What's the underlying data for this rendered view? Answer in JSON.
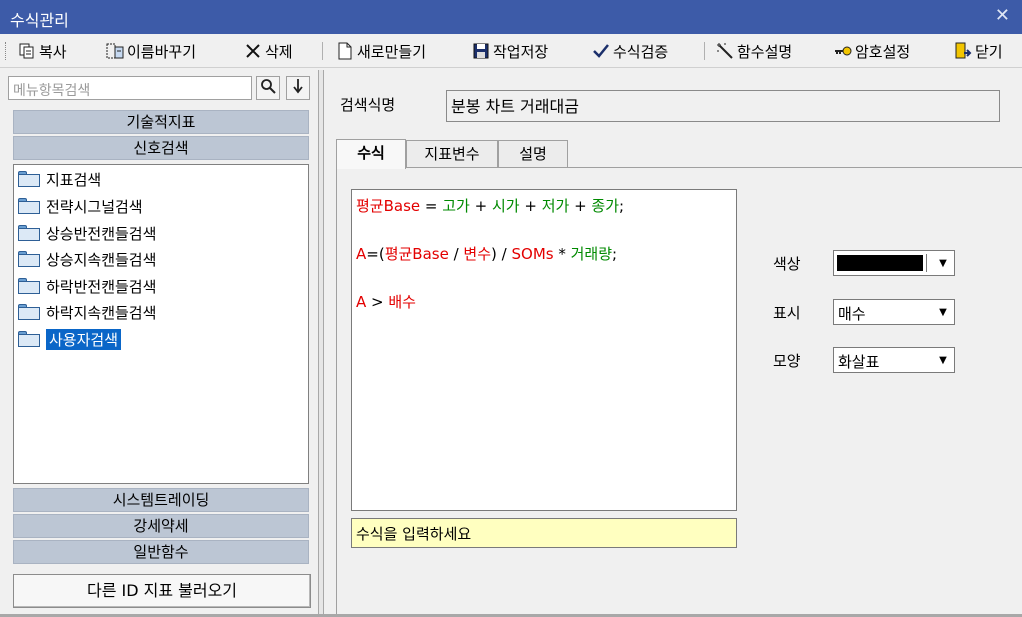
{
  "window": {
    "title": "수식관리"
  },
  "toolbar": {
    "copy": "복사",
    "rename": "이름바꾸기",
    "delete": "삭제",
    "new": "새로만들기",
    "save": "작업저장",
    "verify": "수식검증",
    "func_help": "함수설명",
    "password": "암호설정",
    "close": "닫기"
  },
  "sidebar": {
    "search_placeholder": "메뉴항목검색",
    "categories_top": [
      "기술적지표",
      "신호검색"
    ],
    "tree_items": [
      "지표검색",
      "전략시그널검색",
      "상승반전캔들검색",
      "상승지속캔들검색",
      "하락반전캔들검색",
      "하락지속캔들검색",
      "사용자검색"
    ],
    "selected_item": "사용자검색",
    "categories_bottom": [
      "시스템트레이딩",
      "강세약세",
      "일반함수"
    ],
    "load_button": "다른 ID 지표 불러오기"
  },
  "main": {
    "name_label": "검색식명",
    "name_value": "분봉 차트 거래대금",
    "tabs": [
      "수식",
      "지표변수",
      "설명"
    ],
    "active_tab": "수식",
    "formula": {
      "line1": [
        {
          "t": "평균Base",
          "c": "red"
        },
        {
          "t": " = ",
          "c": "op"
        },
        {
          "t": "고가",
          "c": "green"
        },
        {
          "t": " + ",
          "c": "op"
        },
        {
          "t": "시가",
          "c": "green"
        },
        {
          "t": " + ",
          "c": "op"
        },
        {
          "t": "저가",
          "c": "green"
        },
        {
          "t": " + ",
          "c": "op"
        },
        {
          "t": "종가",
          "c": "green"
        },
        {
          "t": ";",
          "c": "op"
        }
      ],
      "line2": [
        {
          "t": "A",
          "c": "red"
        },
        {
          "t": "=(",
          "c": "op"
        },
        {
          "t": "평균Base",
          "c": "red"
        },
        {
          "t": " / ",
          "c": "op"
        },
        {
          "t": "변수",
          "c": "red"
        },
        {
          "t": ") / ",
          "c": "op"
        },
        {
          "t": "SOMs",
          "c": "red"
        },
        {
          "t": " * ",
          "c": "op"
        },
        {
          "t": "거래량",
          "c": "green"
        },
        {
          "t": ";",
          "c": "op"
        }
      ],
      "line3": [
        {
          "t": "A",
          "c": "red"
        },
        {
          "t": " > ",
          "c": "op"
        },
        {
          "t": "배수",
          "c": "red"
        }
      ]
    },
    "hint": "수식을 입력하세요",
    "props": {
      "color_label": "색상",
      "color_value": "#000000",
      "display_label": "표시",
      "display_value": "매수",
      "shape_label": "모양",
      "shape_value": "화살표"
    }
  },
  "colors": {
    "titlebar": "#3d5ba8",
    "selection": "#0a66c8",
    "category_bar": "#bcc6d4",
    "formula_red": "#e30000",
    "formula_green": "#008a00",
    "hint_bg": "#ffffc0"
  }
}
